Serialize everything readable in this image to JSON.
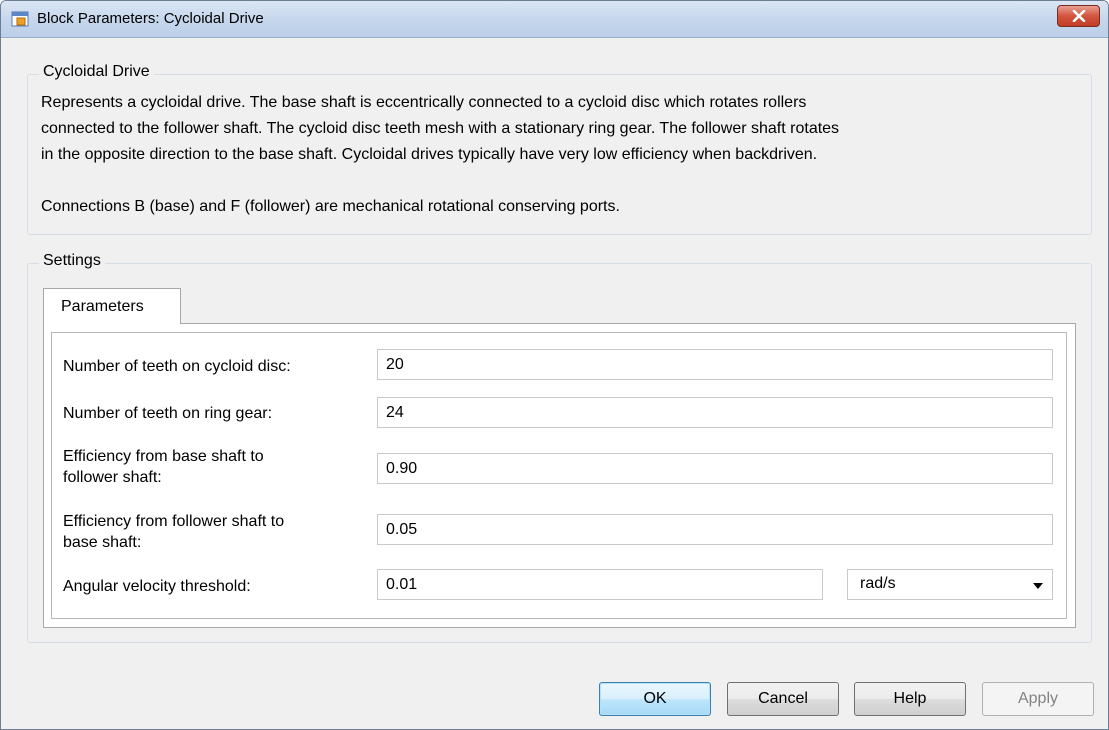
{
  "window": {
    "title": "Block Parameters: Cycloidal Drive"
  },
  "description": {
    "group_title": "Cycloidal Drive",
    "lines": [
      "Represents a cycloidal drive. The base shaft is eccentrically connected to a cycloid disc which rotates rollers",
      "connected to the follower shaft. The cycloid disc teeth mesh with a stationary ring gear. The follower shaft rotates",
      "in the opposite direction to the base shaft. Cycloidal drives typically have very low efficiency when backdriven.",
      "Connections B (base) and F (follower) are mechanical rotational conserving ports."
    ]
  },
  "settings": {
    "group_title": "Settings",
    "tab_label": "Parameters",
    "params": [
      {
        "label_lines": [
          "Number of teeth on cycloid disc:"
        ],
        "value": "20"
      },
      {
        "label_lines": [
          "Number of teeth on ring gear:"
        ],
        "value": "24"
      },
      {
        "label_lines": [
          "Efficiency from base shaft to",
          "follower shaft:"
        ],
        "value": "0.90"
      },
      {
        "label_lines": [
          "Efficiency from follower shaft to",
          "base shaft:"
        ],
        "value": "0.05"
      },
      {
        "label_lines": [
          "Angular velocity threshold:"
        ],
        "value": "0.01",
        "unit": "rad/s"
      }
    ]
  },
  "buttons": {
    "ok": "OK",
    "cancel": "Cancel",
    "help": "Help",
    "apply": "Apply"
  },
  "icons": {
    "app": "simulink-block-icon",
    "close": "close-icon",
    "dropdown": "chevron-down-icon"
  },
  "colors": {
    "close_button": "#c94a34",
    "default_button_border": "#3c7fb1"
  }
}
